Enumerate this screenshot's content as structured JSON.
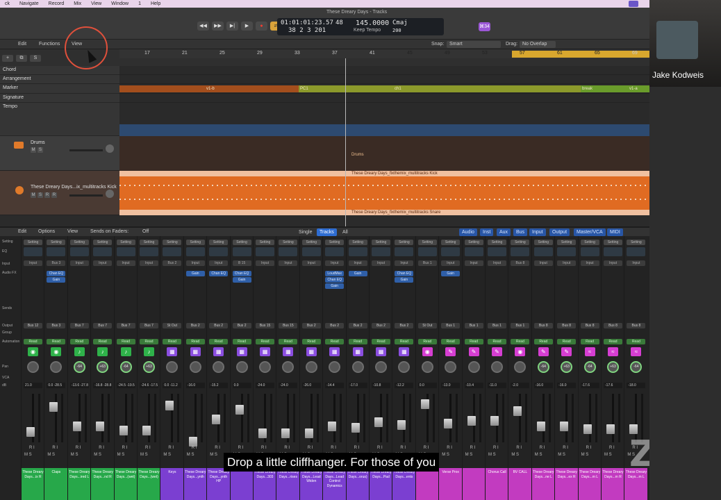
{
  "menubar": {
    "items": [
      "ck",
      "Navigate",
      "Record",
      "Mix",
      "View",
      "Window",
      "1",
      "Help"
    ]
  },
  "window": {
    "title": "These Dreary Days - Tracks"
  },
  "lcd": {
    "position": "01:01:01:23.57",
    "bars": "38  2  3  201",
    "num48": "48",
    "tempo": "145.0000",
    "keep_tempo": "Keep Tempo",
    "key": "Cmaj",
    "num200": "200"
  },
  "badge": "⌘34",
  "tracks_toolbar": {
    "edit": "Edit",
    "functions": "Functions",
    "view": "View",
    "snap_label": "Snap:",
    "snap_value": "Smart",
    "drag_label": "Drag:",
    "drag_value": "No Overlap"
  },
  "ruler": {
    "numbers": [
      "17",
      "21",
      "25",
      "29",
      "33",
      "37",
      "41",
      "45",
      "49",
      "53",
      "57",
      "61",
      "65",
      "69"
    ]
  },
  "global_tracks": {
    "chord": "Chord",
    "arrangement": "Arrangement",
    "marker": "Marker",
    "signature": "Signature",
    "tempo": "Tempo"
  },
  "markers": [
    "v1-b",
    "PC1",
    "ch1",
    "break",
    "v1-a"
  ],
  "tracks": {
    "drums": {
      "name": "Drums",
      "region": "Drums"
    },
    "kick": {
      "name": "These Dreary Days...ix_multitracks Kick",
      "region_top": "These Dreary Days_fixthemix_multitracks Kick",
      "region_bottom": "These Dreary Days_fixthemix_multitracks Snare"
    }
  },
  "mixer_toolbar": {
    "edit": "Edit",
    "options": "Options",
    "view": "View",
    "sends_on_faders": "Sends on Faders:",
    "off": "Off",
    "single": "Single",
    "tracks": "Tracks",
    "all": "All",
    "filters": [
      "Audio",
      "Inst",
      "Aux",
      "Bus",
      "Input",
      "Output",
      "Master/VCA",
      "MIDI"
    ]
  },
  "row_labels": [
    "Setting",
    "EQ",
    "Input",
    "Audio FX",
    "Sends",
    "Output",
    "Group",
    "Automation",
    "",
    "Pan",
    "VCA",
    "dB"
  ],
  "strips": [
    {
      "input": "Input",
      "plugins": [],
      "output": "Bus 12",
      "pan": "",
      "vol": "21.0",
      "icon": "drum",
      "name": "These Dreary Days...ix R",
      "color": "#27a84a"
    },
    {
      "input": "Bus 3",
      "plugins": [
        "Chan EQ",
        "Gain"
      ],
      "output": "Bus 3",
      "pan": "",
      "vol": "0.0  -28.5",
      "icon": "drum",
      "name": "Claps",
      "color": "#27a84a"
    },
    {
      "input": "Input",
      "plugins": [],
      "output": "Bus 7",
      "pan": "-64",
      "vol": "-13.6  -27.8",
      "icon": "guitar",
      "name": "These Dreary Days...ired L",
      "color": "#27a84a"
    },
    {
      "input": "Input",
      "plugins": [],
      "output": "Bus 7",
      "pan": "+63",
      "vol": "-16.8  -28.8",
      "icon": "guitar",
      "name": "These Dreary Days...nd R",
      "color": "#27a84a"
    },
    {
      "input": "Input",
      "plugins": [],
      "output": "Bus 7",
      "pan": "-64",
      "vol": "-24.5  -19.5",
      "icon": "guitar",
      "name": "These Dreary Days...(wet)",
      "color": "#27a84a"
    },
    {
      "input": "Input",
      "plugins": [],
      "output": "Bus 7",
      "pan": "+63",
      "vol": "-24.6  -17.5",
      "icon": "guitar",
      "name": "These Dreary Days...(wet)",
      "color": "#27a84a"
    },
    {
      "input": "Bus 2",
      "plugins": [],
      "output": "St Out",
      "pan": "",
      "vol": "0.0  -11.2",
      "icon": "keys",
      "name": "Keys",
      "color": "#7b3fd1"
    },
    {
      "input": "Input",
      "plugins": [
        "Gain"
      ],
      "output": "Bus 2",
      "pan": "",
      "vol": "-16.0",
      "icon": "keys",
      "name": "These Dreary Days...ynth",
      "color": "#7b3fd1"
    },
    {
      "input": "Input",
      "plugins": [
        "Chan EQ"
      ],
      "output": "Bus 2",
      "pan": "",
      "vol": "-15.2",
      "icon": "keys",
      "name": "These Dreary Days...ynth HP",
      "color": "#7b3fd1"
    },
    {
      "input": "B 15",
      "plugins": [
        "Chan EQ",
        "Gain"
      ],
      "output": "Bus 2",
      "pan": "",
      "vol": "0.0",
      "icon": "keys",
      "name": "",
      "color": "#7b3fd1"
    },
    {
      "input": "Input",
      "plugins": [],
      "output": "Bus 15",
      "pan": "",
      "vol": "-24.0",
      "icon": "keys",
      "name": "These Dreary Days...303",
      "color": "#7b3fd1"
    },
    {
      "input": "Input",
      "plugins": [],
      "output": "Bus 15",
      "pan": "",
      "vol": "-24.0",
      "icon": "keys",
      "name": "These Dreary Days...rises",
      "color": "#7b3fd1"
    },
    {
      "input": "Input",
      "plugins": [],
      "output": "Bus 2",
      "pan": "",
      "vol": "-26.0",
      "icon": "keys",
      "name": "These Dreary Days...Lead Widen",
      "color": "#7b3fd1"
    },
    {
      "input": "Input",
      "plugins": [
        "LoudMax",
        "Chan EQ",
        "Gain"
      ],
      "output": "Bus 2",
      "pan": "",
      "vol": "-14.4",
      "icon": "keys",
      "name": "These Dreary Days...Lead Control Dynamics",
      "color": "#7b3fd1"
    },
    {
      "input": "Input",
      "plugins": [
        "Gain"
      ],
      "output": "Bus 2",
      "pan": "",
      "vol": "-17.0",
      "icon": "keys",
      "name": "These Dreary Days...orus)",
      "color": "#7b3fd1"
    },
    {
      "input": "Input",
      "plugins": [],
      "output": "Bus 2",
      "pan": "",
      "vol": "-10.8",
      "icon": "keys",
      "name": "These Dreary Days...Pad",
      "color": "#7b3fd1"
    },
    {
      "input": "Input",
      "plugins": [
        "Chan EQ",
        "Gain"
      ],
      "output": "Bus 2",
      "pan": "",
      "vol": "-12.2",
      "icon": "keys",
      "name": "These Dreary Days...ents",
      "color": "#7b3fd1"
    },
    {
      "input": "Bus 1",
      "plugins": [],
      "output": "St Out",
      "pan": "",
      "vol": "0.0",
      "icon": "vocal",
      "name": "",
      "color": "#c23bc0"
    },
    {
      "input": "Input",
      "plugins": [
        "Gain"
      ],
      "output": "Bus 1",
      "pan": "",
      "vol": "-13.0",
      "icon": "mic",
      "name": "Verse Prox",
      "color": "#c23bc0"
    },
    {
      "input": "Input",
      "plugins": [],
      "output": "Bus 1",
      "pan": "",
      "vol": "-10.4",
      "icon": "mic",
      "name": "",
      "color": "#c23bc0"
    },
    {
      "input": "Input",
      "plugins": [],
      "output": "Bus 1",
      "pan": "",
      "vol": "-11.0",
      "icon": "mic",
      "name": "Chorus Call",
      "color": "#c23bc0"
    },
    {
      "input": "Bus 8",
      "plugins": [],
      "output": "Bus 1",
      "pan": "",
      "vol": "-2.0",
      "icon": "vocal",
      "name": "BV CALL",
      "color": "#c23bc0"
    },
    {
      "input": "Input",
      "plugins": [],
      "output": "Bus 8",
      "pan": "-64",
      "vol": "-16.0",
      "icon": "mic",
      "name": "These Dreary Days...ne L",
      "color": "#c23bc0"
    },
    {
      "input": "Input",
      "plugins": [],
      "output": "Bus 8",
      "pan": "+63",
      "vol": "-16.0",
      "icon": "mic",
      "name": "These Dreary Days...ex R",
      "color": "#c23bc0"
    },
    {
      "input": "Input",
      "plugins": [],
      "output": "Bus 8",
      "pan": "-64",
      "vol": "-17.6",
      "icon": "wave",
      "name": "These Dreary Days...m L",
      "color": "#c23bc0"
    },
    {
      "input": "Input",
      "plugins": [],
      "output": "Bus 8",
      "pan": "+63",
      "vol": "-17.6",
      "icon": "wave",
      "name": "These Dreary Days...m R",
      "color": "#c23bc0"
    },
    {
      "input": "Input",
      "plugins": [],
      "output": "Bus 8",
      "pan": "-64",
      "vol": "-18.0",
      "icon": "wave",
      "name": "These Dreary Days...m L",
      "color": "#c23bc0"
    }
  ],
  "caption": "Drop a little cliffhanger. For those of  you",
  "zoom_watermark": "ZOO",
  "participant": {
    "name": "Jake Kodweis"
  },
  "colors": {
    "region_orange": "#e06b22",
    "marker_brown": "#a34e1d",
    "marker_olive": "#8c9a2b",
    "cycle_yellow": "#d8a72e",
    "accent_blue": "#2e6dd2"
  }
}
